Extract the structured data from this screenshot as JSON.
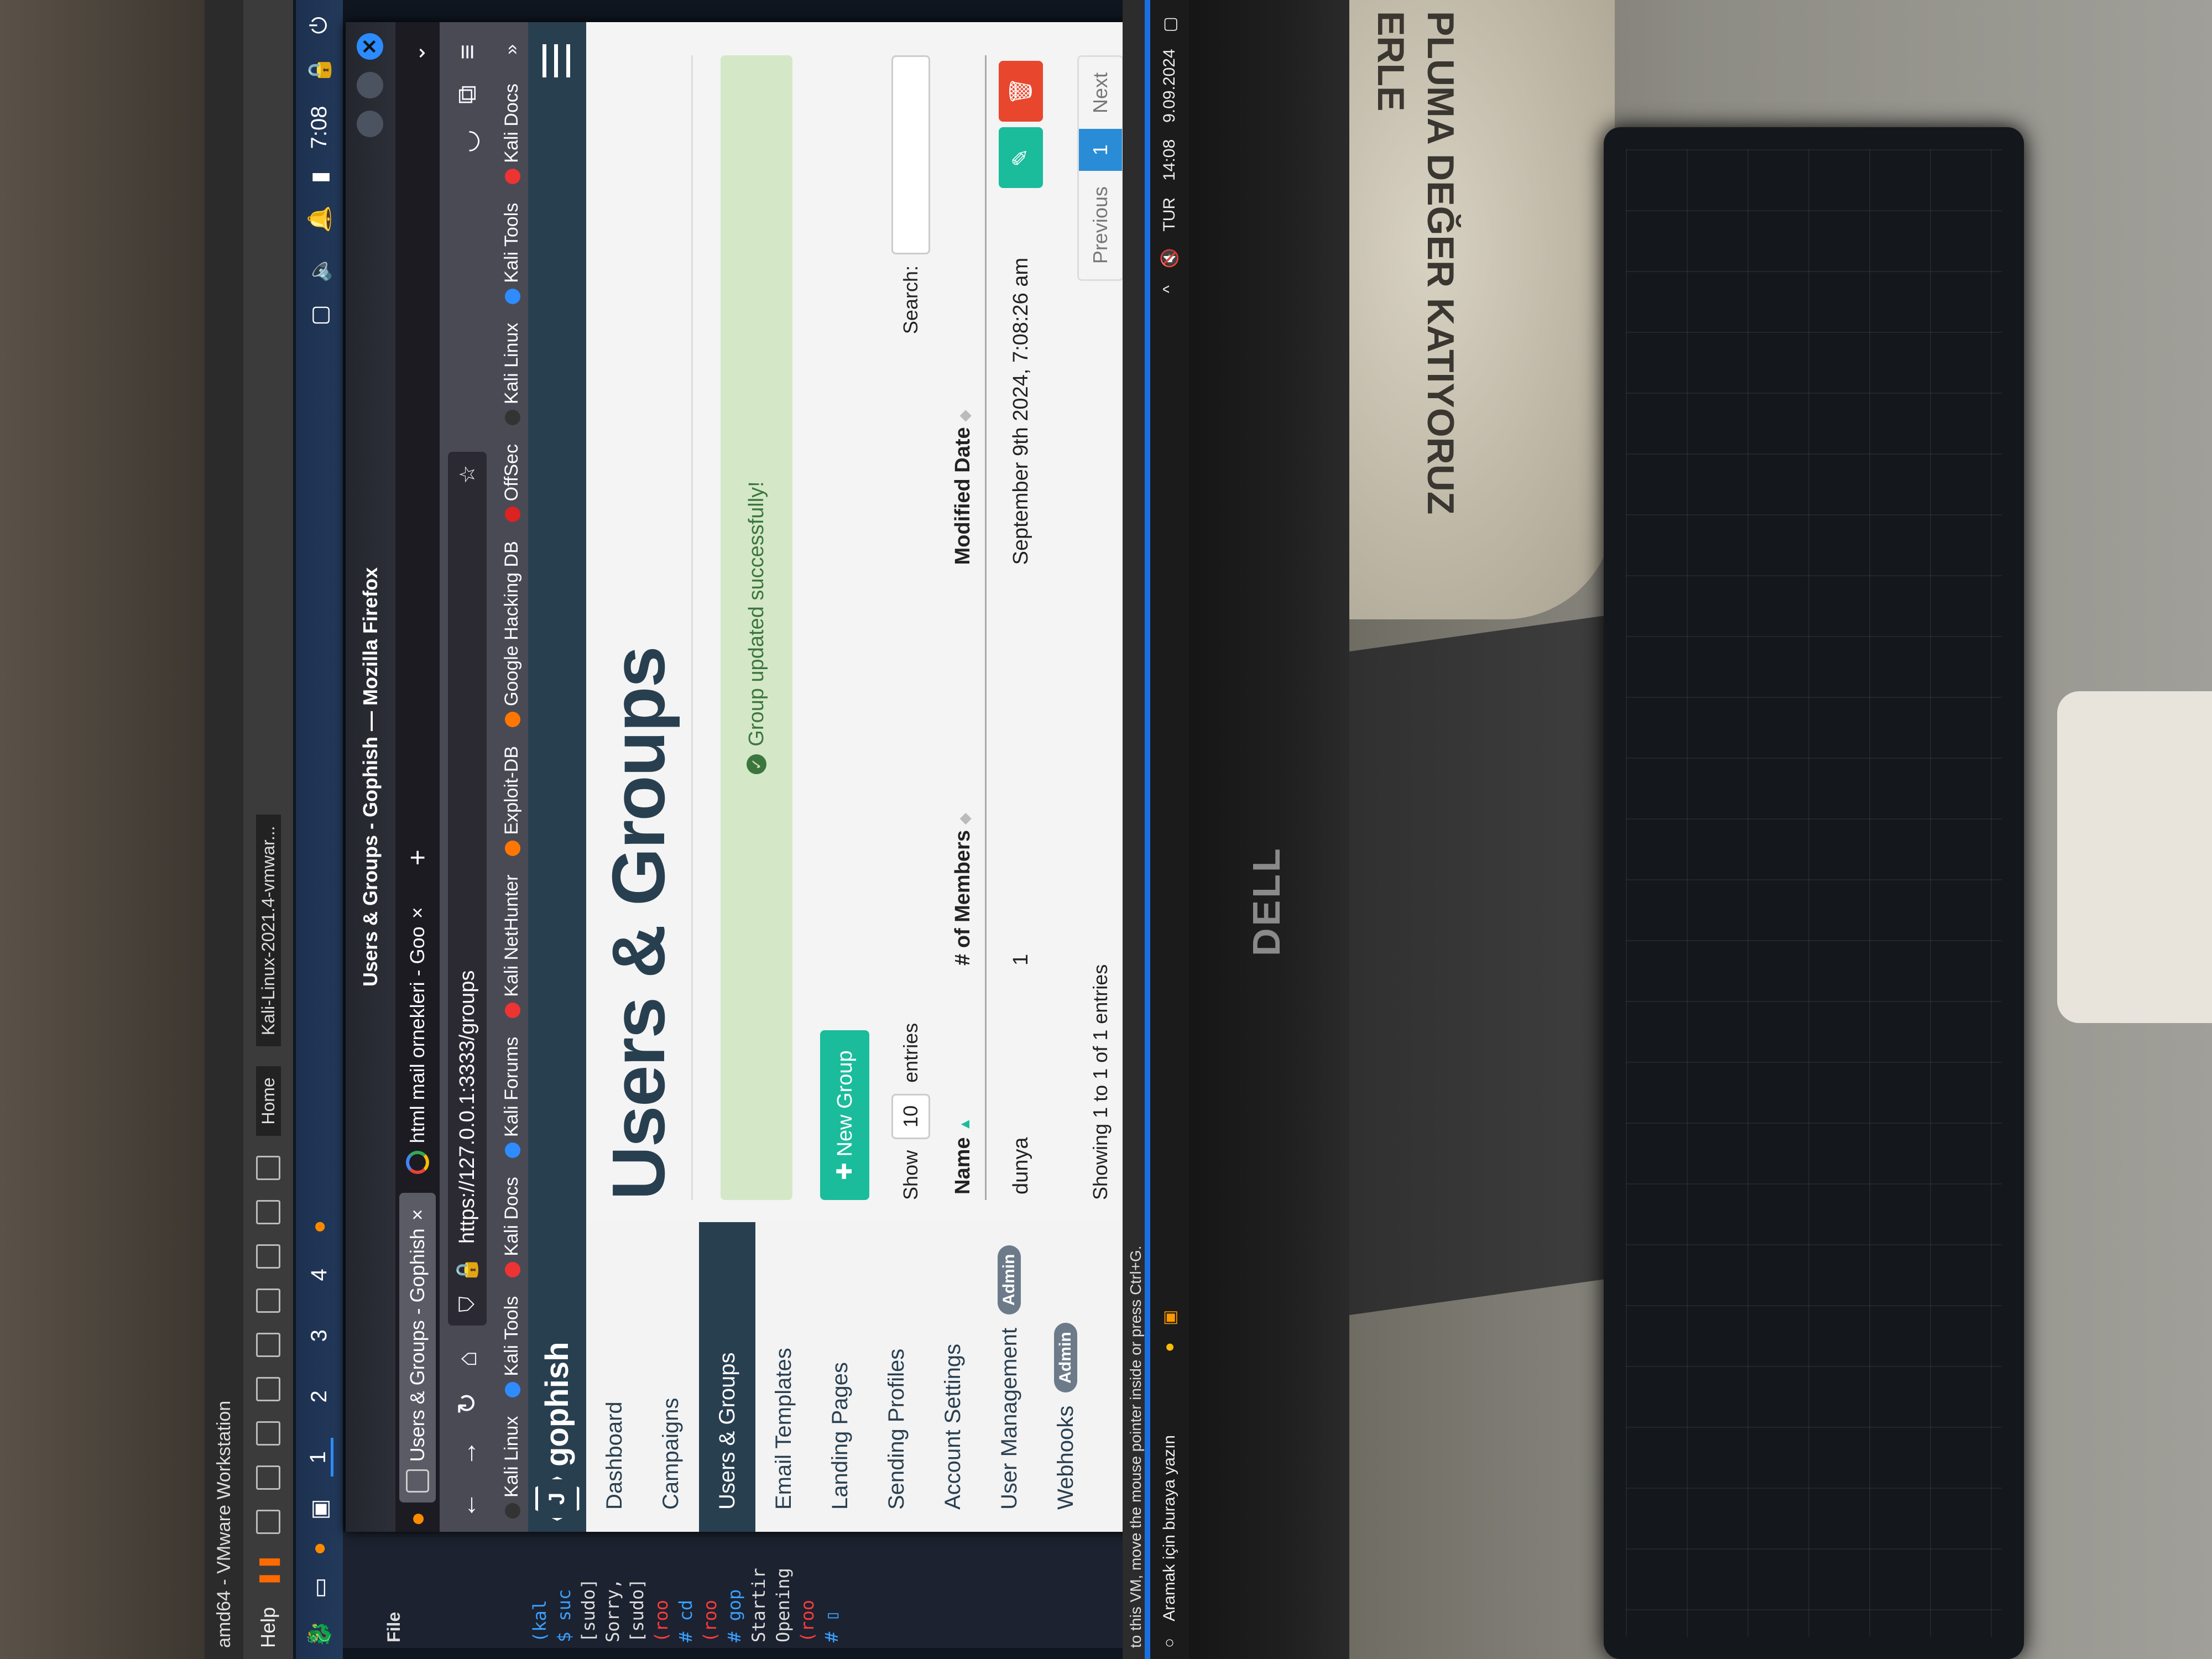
{
  "vmware": {
    "title": "amd64 - VMware Workstation",
    "menu_help": "Help",
    "tab_home": "Home",
    "tab_vm": "Kali-Linux-2021.4-vmwar...",
    "status": "to this VM, move the mouse pointer inside or press Ctrl+G."
  },
  "kali_panel": {
    "workspaces": [
      "1",
      "2",
      "3",
      "4"
    ],
    "clock": "7:08"
  },
  "terminal": {
    "menu_file": "File",
    "lines": [
      "(kal",
      "$ suc",
      "[sudo]",
      "Sorry,",
      "[sudo]",
      "(roo",
      "# cd",
      "(roo",
      "# gop",
      "Startir",
      "Opening",
      "(roo",
      "# ▯"
    ]
  },
  "firefox": {
    "window_title": "Users & Groups - Gophish — Mozilla Firefox",
    "tabs": [
      {
        "label": "Users & Groups - Gophish",
        "close": "×"
      },
      {
        "label": "html mail ornekleri - Goo",
        "close": "×"
      }
    ],
    "new_tab": "+",
    "url": "https://127.0.0.1:3333/groups",
    "bookmarks": [
      "Kali Linux",
      "Kali Tools",
      "Kali Docs",
      "Kali Forums",
      "Kali NetHunter",
      "Exploit-DB",
      "Google Hacking DB",
      "OffSec",
      "Kali Linux",
      "Kali Tools",
      "Kali Docs"
    ],
    "bookmarks_more": "»"
  },
  "gophish": {
    "brand": "gophish",
    "sidebar": [
      {
        "label": "Dashboard"
      },
      {
        "label": "Campaigns"
      },
      {
        "label": "Users & Groups",
        "active": true
      },
      {
        "label": "Email Templates"
      },
      {
        "label": "Landing Pages"
      },
      {
        "label": "Sending Profiles"
      },
      {
        "label": "Account Settings"
      },
      {
        "label": "User Management",
        "badge": "Admin"
      },
      {
        "label": "Webhooks",
        "badge": "Admin"
      }
    ],
    "page_title": "Users & Groups",
    "alert": "Group updated successfully!",
    "new_group": "New Group",
    "show": "Show",
    "entries_value": "10",
    "entries": "entries",
    "search_label": "Search:",
    "columns": [
      "Name",
      "# of Members",
      "Modified Date"
    ],
    "rows": [
      {
        "name": "dunya",
        "members": "1",
        "modified": "September 9th 2024, 7:08:26 am"
      }
    ],
    "showing": "Showing 1 to 1 of 1 entries",
    "prev": "Previous",
    "page": "1",
    "next": "Next"
  },
  "windows_taskbar": {
    "search_placeholder": "Aramak için buraya yazın",
    "language": "TUR",
    "time": "14:08",
    "date": "9.09.2024"
  },
  "photo": {
    "monitor_brand": "DELL",
    "bag_text": [
      "PLUMA DEĞER KATIYORUZ",
      "ERLE"
    ]
  },
  "colors": {
    "gophish_navy": "#283f50",
    "gophish_teal": "#1abc9c",
    "danger": "#e8472e",
    "alert_bg": "#d4e8c8"
  }
}
